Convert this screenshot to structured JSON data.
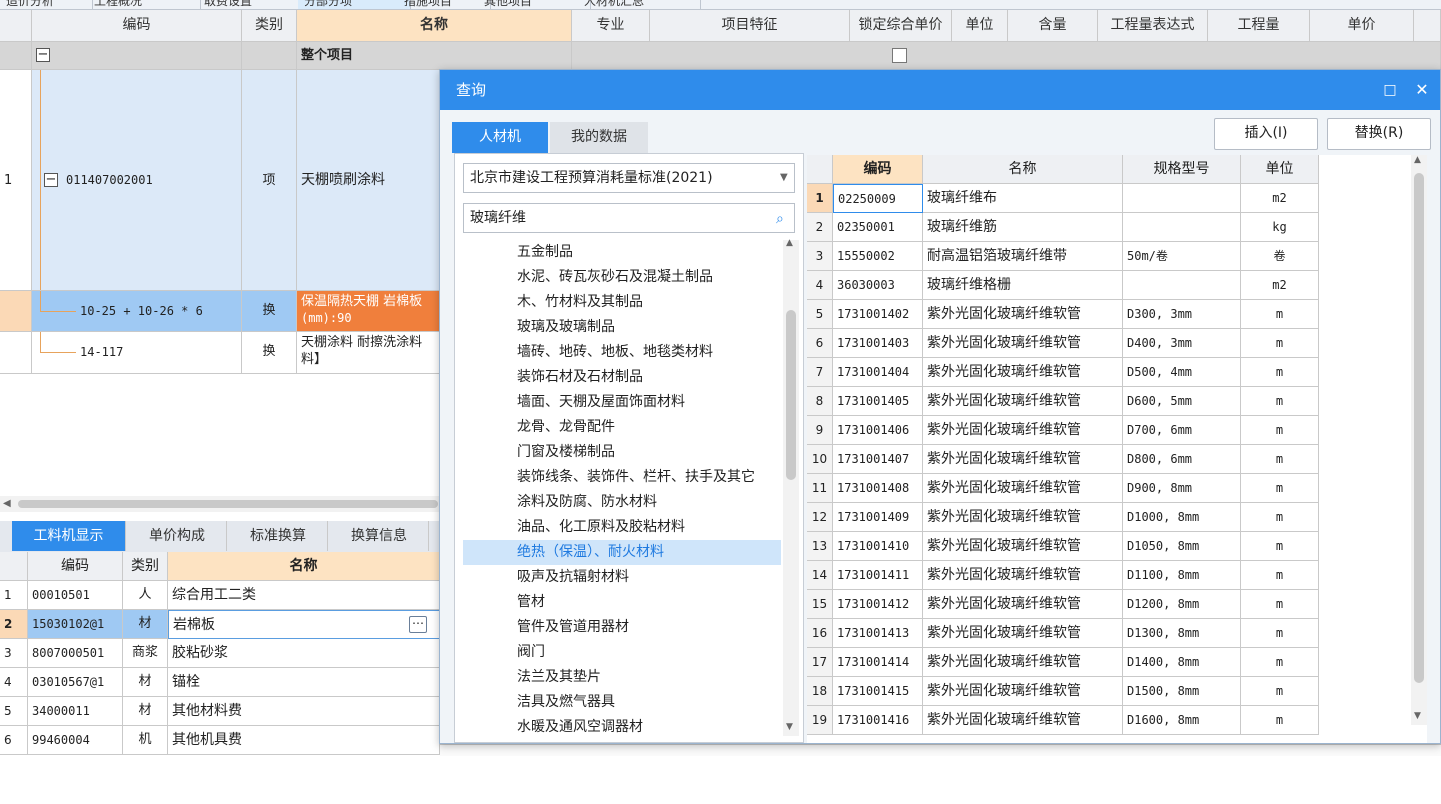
{
  "top_tabs": [
    "造价分析",
    "工程概况",
    "取费设置",
    "分部分项",
    "措施项目",
    "其他项目",
    "人材机汇总"
  ],
  "main_grid": {
    "headers": [
      "编码",
      "类别",
      "名称",
      "专业",
      "项目特征",
      "锁定综合单价",
      "单位",
      "含量",
      "工程量表达式",
      "工程量",
      "单价"
    ],
    "project_row": {
      "expand": "−",
      "name": "整个项目"
    },
    "rows": [
      {
        "no": "1",
        "code": "011407002001",
        "type": "项",
        "name": "天棚喷刷涂料"
      },
      {
        "no": "",
        "code": "10-25 + 10-26 * 6",
        "type": "换",
        "name": "保温隔热天棚 岩棉板",
        "name2": "(mm):90"
      },
      {
        "no": "",
        "code": "14-117",
        "type": "换",
        "name": "天棚涂料 耐擦洗涂料",
        "name2": "料】"
      }
    ]
  },
  "bottom": {
    "tabs": [
      "工料机显示",
      "单价构成",
      "标准换算",
      "换算信息"
    ],
    "headers": [
      "编码",
      "类别",
      "名称"
    ],
    "rows": [
      {
        "no": "1",
        "code": "00010501",
        "type": "人",
        "name": "综合用工二类"
      },
      {
        "no": "2",
        "code": "15030102@1",
        "type": "材",
        "name": "岩棉板"
      },
      {
        "no": "3",
        "code": "8007000501",
        "type": "商浆",
        "name": "胶粘砂浆"
      },
      {
        "no": "4",
        "code": "03010567@1",
        "type": "材",
        "name": "锚栓"
      },
      {
        "no": "5",
        "code": "34000011",
        "type": "材",
        "name": "其他材料费"
      },
      {
        "no": "6",
        "code": "99460004",
        "type": "机",
        "name": "其他机具费"
      }
    ]
  },
  "dialog": {
    "title": "查询",
    "controls": {
      "restore": "□",
      "close": "✕"
    },
    "tabs": [
      "人材机",
      "我的数据"
    ],
    "buttons": {
      "insert": "插入(I)",
      "replace": "替换(R)"
    },
    "standard": "北京市建设工程预算消耗量标准(2021)",
    "search_value": "玻璃纤维",
    "tree": [
      "五金制品",
      "水泥、砖瓦灰砂石及混凝土制品",
      "木、竹材料及其制品",
      "玻璃及玻璃制品",
      "墙砖、地砖、地板、地毯类材料",
      "装饰石材及石材制品",
      "墙面、天棚及屋面饰面材料",
      "龙骨、龙骨配件",
      "门窗及楼梯制品",
      "装饰线条、装饰件、栏杆、扶手及其它",
      "涂料及防腐、防水材料",
      "油品、化工原料及胶粘材料",
      "绝热（保温）、耐火材料",
      "吸声及抗辐射材料",
      "管材",
      "管件及管道用器材",
      "阀门",
      "法兰及其垫片",
      "洁具及燃气器具",
      "水暖及通风空调器材"
    ],
    "tree_selected": 12,
    "grid_headers": [
      "编码",
      "名称",
      "规格型号",
      "单位"
    ],
    "grid_rows": [
      {
        "no": "1",
        "code": "02250009",
        "name": "玻璃纤维布",
        "spec": "",
        "unit": "m2"
      },
      {
        "no": "2",
        "code": "02350001",
        "name": "玻璃纤维筋",
        "spec": "",
        "unit": "kg"
      },
      {
        "no": "3",
        "code": "15550002",
        "name": "耐高温铝箔玻璃纤维带",
        "spec": "50m/卷",
        "unit": "卷"
      },
      {
        "no": "4",
        "code": "36030003",
        "name": "玻璃纤维格栅",
        "spec": "",
        "unit": "m2"
      },
      {
        "no": "5",
        "code": "1731001402",
        "name": "紫外光固化玻璃纤维软管",
        "spec": "D300, 3mm",
        "unit": "m"
      },
      {
        "no": "6",
        "code": "1731001403",
        "name": "紫外光固化玻璃纤维软管",
        "spec": "D400, 3mm",
        "unit": "m"
      },
      {
        "no": "7",
        "code": "1731001404",
        "name": "紫外光固化玻璃纤维软管",
        "spec": "D500, 4mm",
        "unit": "m"
      },
      {
        "no": "8",
        "code": "1731001405",
        "name": "紫外光固化玻璃纤维软管",
        "spec": "D600, 5mm",
        "unit": "m"
      },
      {
        "no": "9",
        "code": "1731001406",
        "name": "紫外光固化玻璃纤维软管",
        "spec": "D700, 6mm",
        "unit": "m"
      },
      {
        "no": "10",
        "code": "1731001407",
        "name": "紫外光固化玻璃纤维软管",
        "spec": "D800, 6mm",
        "unit": "m"
      },
      {
        "no": "11",
        "code": "1731001408",
        "name": "紫外光固化玻璃纤维软管",
        "spec": "D900, 8mm",
        "unit": "m"
      },
      {
        "no": "12",
        "code": "1731001409",
        "name": "紫外光固化玻璃纤维软管",
        "spec": "D1000, 8mm",
        "unit": "m"
      },
      {
        "no": "13",
        "code": "1731001410",
        "name": "紫外光固化玻璃纤维软管",
        "spec": "D1050, 8mm",
        "unit": "m"
      },
      {
        "no": "14",
        "code": "1731001411",
        "name": "紫外光固化玻璃纤维软管",
        "spec": "D1100, 8mm",
        "unit": "m"
      },
      {
        "no": "15",
        "code": "1731001412",
        "name": "紫外光固化玻璃纤维软管",
        "spec": "D1200, 8mm",
        "unit": "m"
      },
      {
        "no": "16",
        "code": "1731001413",
        "name": "紫外光固化玻璃纤维软管",
        "spec": "D1300, 8mm",
        "unit": "m"
      },
      {
        "no": "17",
        "code": "1731001414",
        "name": "紫外光固化玻璃纤维软管",
        "spec": "D1400, 8mm",
        "unit": "m"
      },
      {
        "no": "18",
        "code": "1731001415",
        "name": "紫外光固化玻璃纤维软管",
        "spec": "D1500, 8mm",
        "unit": "m"
      },
      {
        "no": "19",
        "code": "1731001416",
        "name": "紫外光固化玻璃纤维软管",
        "spec": "D1600, 8mm",
        "unit": "m"
      }
    ],
    "selected_row": 0
  },
  "colors": {
    "accent": "#2f8ceb",
    "header_highlight": "#fde3c2",
    "row_selected": "#9fc9f3",
    "row_orange": "#f07f3c"
  }
}
